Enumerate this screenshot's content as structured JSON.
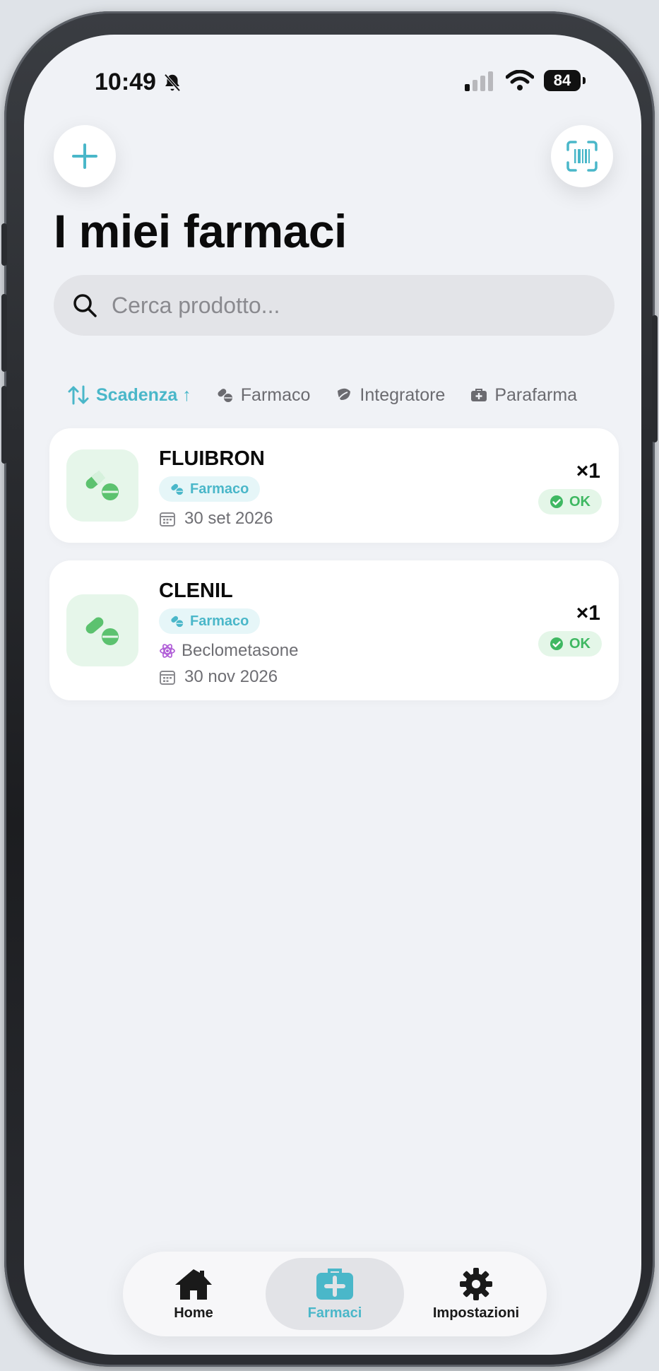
{
  "status_bar": {
    "time": "10:49",
    "battery": "84"
  },
  "page": {
    "title": "I miei farmaci"
  },
  "search": {
    "placeholder": "Cerca prodotto..."
  },
  "filters": [
    {
      "label": "Scadenza ↑",
      "icon": "sort-icon",
      "active": true
    },
    {
      "label": "Farmaco",
      "icon": "pills-icon",
      "active": false
    },
    {
      "label": "Integratore",
      "icon": "leaf-icon",
      "active": false
    },
    {
      "label": "Parafarma",
      "icon": "kit-icon",
      "active": false
    }
  ],
  "products": [
    {
      "name": "FLUIBRON",
      "category": "Farmaco",
      "expiry": "30 set 2026",
      "quantity": "×1",
      "status": "OK"
    },
    {
      "name": "CLENIL",
      "category": "Farmaco",
      "active_ingredient": "Beclometasone",
      "expiry": "30 nov 2026",
      "quantity": "×1",
      "status": "OK"
    }
  ],
  "tabbar": [
    {
      "label": "Home",
      "icon": "home-icon",
      "active": false
    },
    {
      "label": "Farmaci",
      "icon": "medkit-icon",
      "active": true
    },
    {
      "label": "Impostazioni",
      "icon": "gear-icon",
      "active": false
    }
  ],
  "colors": {
    "accent": "#4ab7c9",
    "ok_green": "#3fb862",
    "background": "#f0f2f6"
  }
}
